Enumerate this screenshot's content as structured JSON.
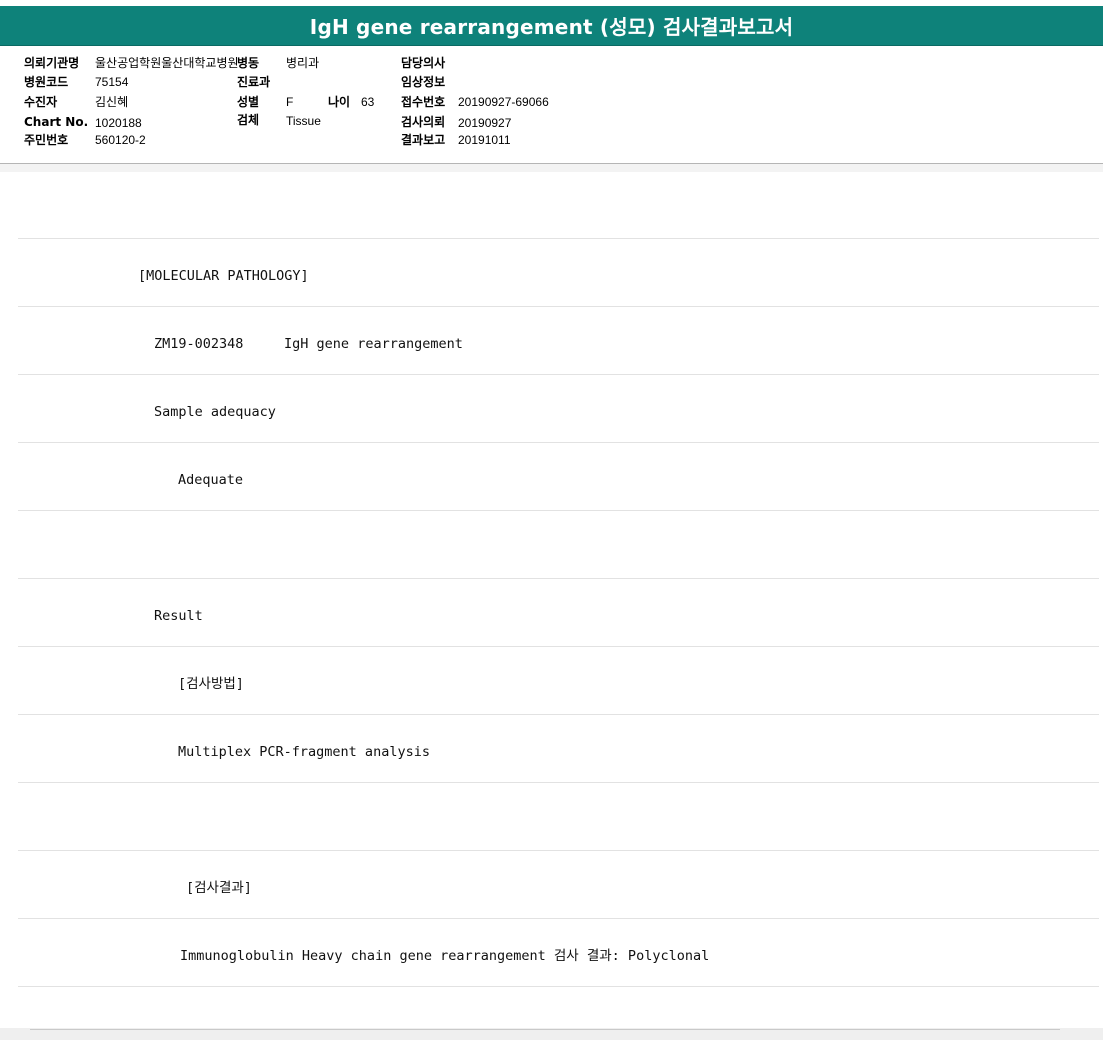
{
  "report": {
    "title": "IgH gene rearrangement (성모) 검사결과보고서"
  },
  "header": {
    "institution_label": "의뢰기관명",
    "institution_value": "울산공업학원울산대학교병원",
    "ward_label": "병동",
    "ward_value": "병리과",
    "doctor_label": "담당의사",
    "doctor_value": "",
    "hospital_code_label": "병원코드",
    "hospital_code_value": "75154",
    "department_label": "진료과",
    "department_value": "",
    "clinical_info_label": "임상정보",
    "clinical_info_value": "",
    "patient_label": "수진자",
    "patient_value": "김신혜",
    "sex_label": "성별",
    "sex_value": "F",
    "age_label": "나이",
    "age_value": "63",
    "receipt_no_label": "접수번호",
    "receipt_no_value": "20190927-69066",
    "chart_no_label": "Chart No.",
    "chart_no_value": "1020188",
    "specimen_label": "검체",
    "specimen_value": "Tissue",
    "request_date_label": "검사의뢰",
    "request_date_value": "20190927",
    "resident_no_label": "주민번호",
    "resident_no_value": "560120-2",
    "report_date_label": "결과보고",
    "report_date_value": "20191011"
  },
  "lines": [
    "",
    "[MOLECULAR PATHOLOGY]",
    "ZM19-002348     IgH gene rearrangement",
    "Sample adequacy",
    "Adequate",
    "",
    "Result",
    "[검사방법]",
    "Multiplex PCR-fragment analysis",
    "",
    "[검사결과]",
    "Immunoglobulin Heavy chain gene rearrangement 검사 결과: Polyclonal"
  ],
  "colors": {
    "title_bar": "#0e827a",
    "title_text": "#ffffff",
    "divider": "#e2e2e2"
  }
}
